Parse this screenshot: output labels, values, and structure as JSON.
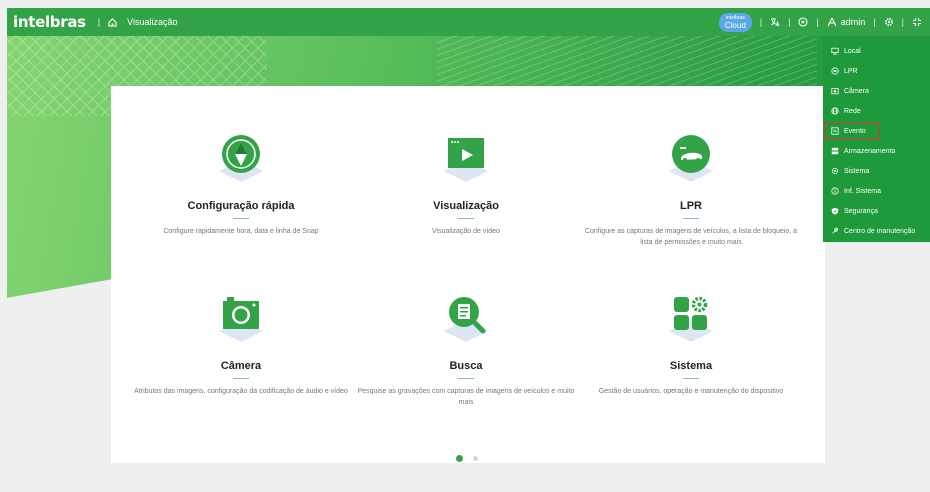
{
  "topbar": {
    "brand": "intelbras",
    "breadcrumb": "Visualização",
    "cloud_badge_small": "intelbras",
    "cloud_badge": "Cloud",
    "user": "admin",
    "separator": "|"
  },
  "tiles": [
    {
      "title": "Configuração rápida",
      "desc": "Configure rapidamente hora, data e linha de Snap",
      "icon": "compass-icon"
    },
    {
      "title": "Visualização",
      "desc": "Visualização de vídeo",
      "icon": "video-play-icon"
    },
    {
      "title": "LPR",
      "desc": "Configure as capturas de imagens de veículos, a lista de bloqueio, a lista de permissões e muito mais",
      "icon": "car-plate-icon"
    },
    {
      "title": "Câmera",
      "desc": "Atributos das imagens, configuração da codificação de áudio e vídeo",
      "icon": "camera-icon"
    },
    {
      "title": "Busca",
      "desc": "Pesquise as gravações com capturas de imagens de veículos e muito mais",
      "icon": "search-document-icon"
    },
    {
      "title": "Sistema",
      "desc": "Gestão de usuários, operação e manutenção do dispositivo",
      "icon": "system-grid-icon"
    }
  ],
  "menu": {
    "items": [
      {
        "label": "Local",
        "icon": "monitor-icon"
      },
      {
        "label": "LPR",
        "icon": "plate-icon"
      },
      {
        "label": "Câmera",
        "icon": "camera-icon"
      },
      {
        "label": "Rede",
        "icon": "globe-icon"
      },
      {
        "label": "Evento",
        "icon": "event-icon",
        "active": true
      },
      {
        "label": "Armazenamento",
        "icon": "storage-icon"
      },
      {
        "label": "Sistema",
        "icon": "gear-icon"
      },
      {
        "label": "Inf. Sistema",
        "icon": "info-icon"
      },
      {
        "label": "Segurança",
        "icon": "shield-icon"
      },
      {
        "label": "Centro de manutenção",
        "icon": "maintenance-icon"
      }
    ]
  },
  "pagination": {
    "pages": 2,
    "current": 1
  },
  "colors": {
    "brand_green": "#32a347",
    "menu_green": "#1f9a3a",
    "highlight_red": "#e0312b",
    "cloud_blue": "#5aa9e6"
  }
}
